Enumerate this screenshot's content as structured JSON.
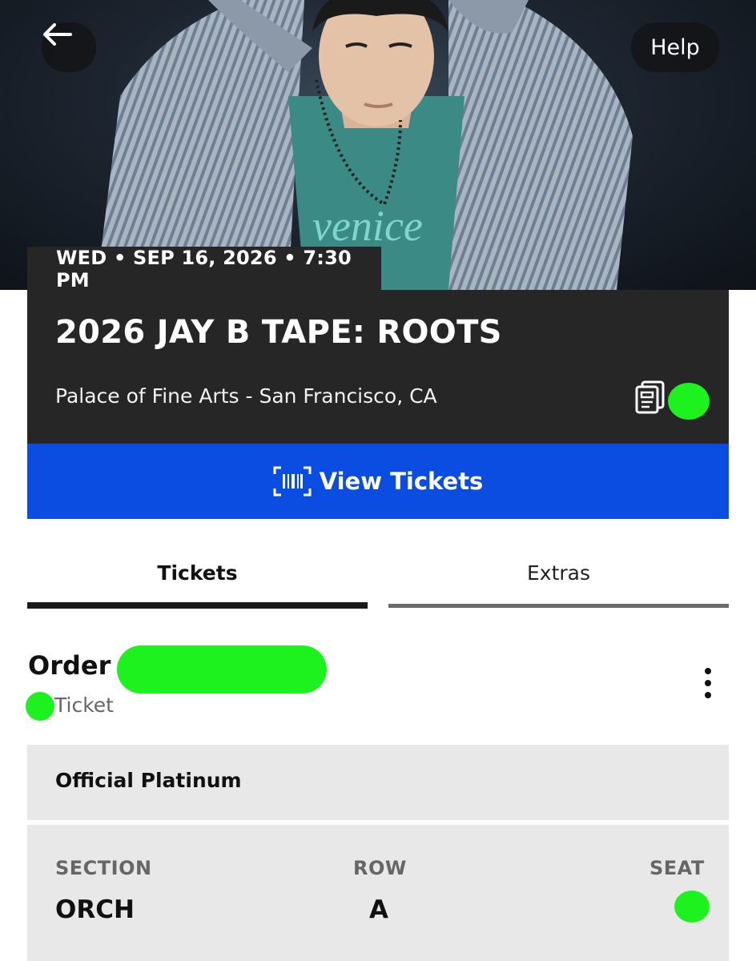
{
  "header": {
    "help_label": "Help",
    "back_icon": "arrow-left-icon"
  },
  "event": {
    "date_line": "WED • SEP 16, 2026 • 7:30 PM",
    "title": "2026 JAY B TAPE: ROOTS",
    "venue": "Palace of Fine Arts - San Francisco, CA"
  },
  "actions": {
    "view_tickets_label": "View Tickets",
    "view_tickets_icon": "barcode-scan-icon"
  },
  "tabs": [
    {
      "label": "Tickets",
      "active": true
    },
    {
      "label": "Extras",
      "active": false
    }
  ],
  "order": {
    "label": "Order #",
    "ticket_label": "Ticket"
  },
  "ticket": {
    "tier": "Official Platinum",
    "section_label": "SECTION",
    "section_value": "ORCH",
    "row_label": "ROW",
    "row_value": "A",
    "seat_label": "SEAT"
  },
  "colors": {
    "accent_blue": "#0b4de0",
    "card_dark": "#262626",
    "redaction_green": "#1ef21e"
  }
}
